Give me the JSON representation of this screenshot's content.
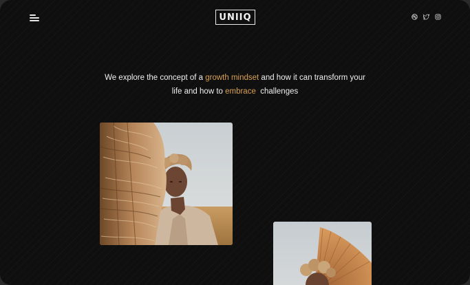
{
  "brand": {
    "logo_text": "UNIIQ"
  },
  "nav": {
    "menu_icon": "hamburger-menu-icon"
  },
  "social": {
    "icons": [
      "dribbble-icon",
      "twitter-icon",
      "instagram-icon"
    ]
  },
  "hero": {
    "text_before": "We explore the concept of a ",
    "highlight_1": "growth mindset",
    "text_mid": " and how it can transform your life and how to ",
    "highlight_2": "embrace",
    "text_after": "  challenges"
  },
  "colors": {
    "background": "#0f0f0f",
    "accent": "#d8a054",
    "text": "#f0f0f0"
  }
}
